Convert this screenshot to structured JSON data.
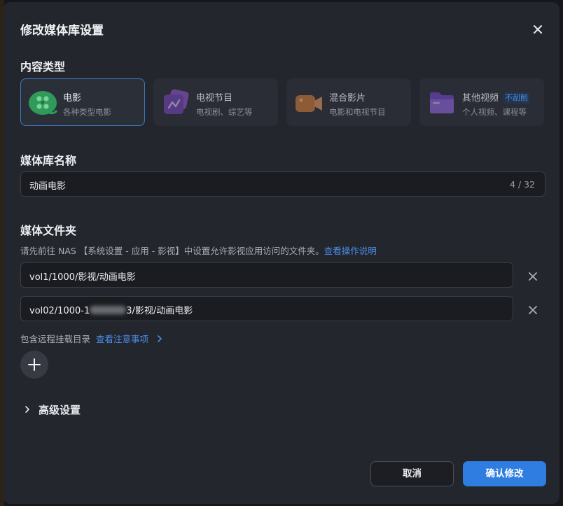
{
  "dialog": {
    "title": "修改媒体库设置"
  },
  "content_type": {
    "label": "内容类型",
    "options": [
      {
        "name": "电影",
        "desc": "各种类型电影",
        "selected": true
      },
      {
        "name": "电视节目",
        "desc": "电视剧、综艺等",
        "selected": false
      },
      {
        "name": "混合影片",
        "desc": "电影和电视节目",
        "selected": false
      },
      {
        "name": "其他视频",
        "tag": "不刮削",
        "desc": "个人视频、课程等",
        "selected": false
      }
    ]
  },
  "library_name": {
    "label": "媒体库名称",
    "value": "动画电影",
    "counter": "4 / 32"
  },
  "folders": {
    "label": "媒体文件夹",
    "hint": "请先前往 NAS 【系统设置 - 应用 - 影视】中设置允许影视应用访问的文件夹。",
    "hint_link": "查看操作说明",
    "paths": [
      {
        "prefix": "vol1/1000/影视/动画电影"
      },
      {
        "prefix": "vol02/1000-1",
        "suffix": "3/影视/动画电影"
      }
    ],
    "remote_label": "包含远程挂载目录",
    "remote_link": "查看注意事项"
  },
  "advanced": {
    "label": "高级设置"
  },
  "actions": {
    "cancel": "取消",
    "confirm": "确认修改"
  },
  "colors": {
    "accent": "#2f7de1",
    "dialog_bg": "#23262d",
    "link": "#4a8ee8"
  }
}
